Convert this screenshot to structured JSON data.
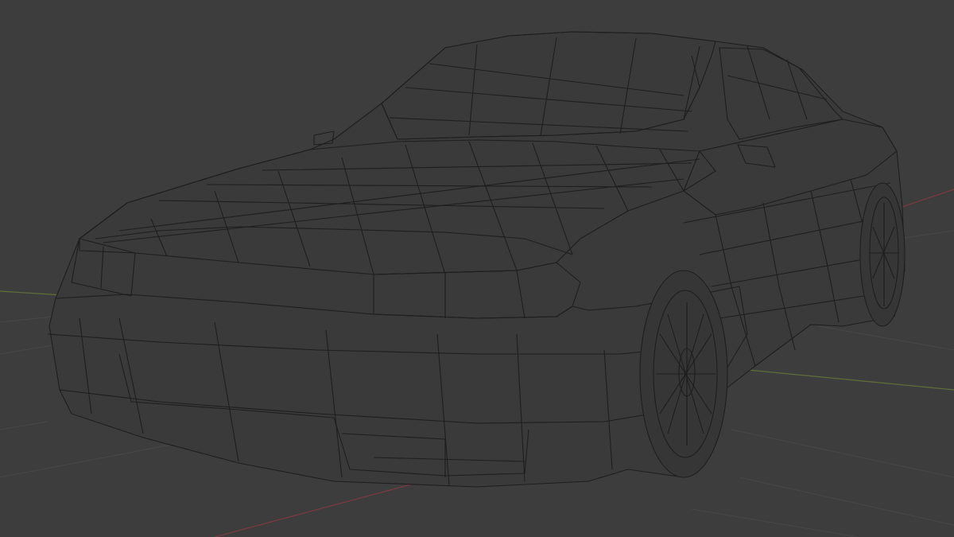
{
  "viewport": {
    "shading": "wireframe",
    "colors": {
      "background": "#3d3d3d",
      "grid": "#484848",
      "wire": "#1e1e1e",
      "body_fill": "#3a3a3a",
      "x_axis": "#8a3b44",
      "y_axis": "#667a36"
    }
  },
  "model": {
    "name": "car-wireframe",
    "parts": [
      "body",
      "hood",
      "windshield",
      "roof",
      "side-window",
      "side-mirror",
      "headlight-left",
      "headlight-right",
      "bumper",
      "front-wheel",
      "rear-wheel"
    ]
  }
}
